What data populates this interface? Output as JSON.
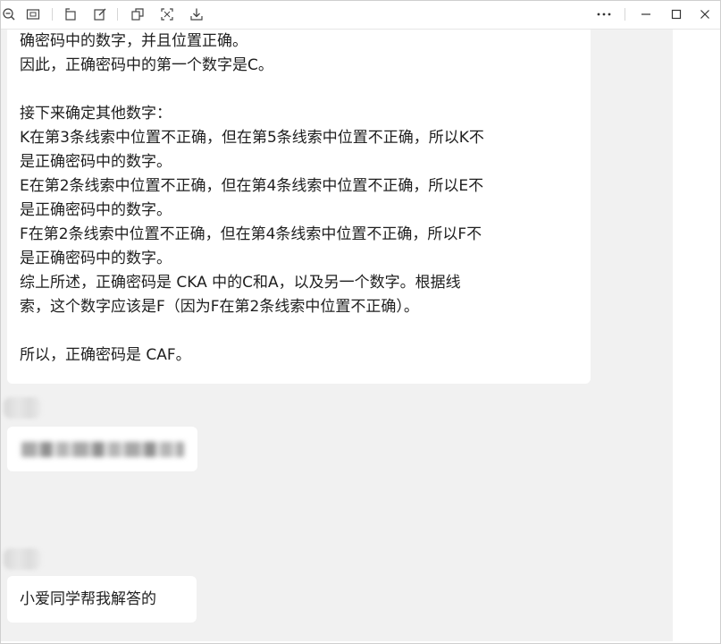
{
  "toolbar": {
    "left_icons": [
      "zoom-out-icon",
      "fit-window-icon",
      "rotate-icon",
      "edit-icon",
      "copy-image-icon",
      "crop-icon",
      "download-icon"
    ],
    "right_icons": [
      "more-icon",
      "minimize-icon",
      "maximize-icon",
      "close-icon"
    ]
  },
  "chat": {
    "answer_lines": [
      "确密码中的数字，并且位置正确。",
      "因此，正确密码中的第一个数字是C。",
      "",
      "接下来确定其他数字：",
      "K在第3条线索中位置不正确，但在第5条线索中位置不正确，所以K不",
      "是正确密码中的数字。",
      "E在第2条线索中位置不正确，但在第4条线索中位置不正确，所以E不",
      "是正确密码中的数字。",
      "F在第2条线索中位置不正确，但在第4条线索中位置不正确，所以F不",
      "是正确密码中的数字。",
      "综上所述，正确密码是 CKA 中的C和A，以及另一个数字。根据线",
      "索，这个数字应该是F（因为F在第2条线索中位置不正确）。",
      "",
      "所以，正确密码是 CAF。"
    ],
    "last_message": "小爱同学帮我解答的"
  }
}
